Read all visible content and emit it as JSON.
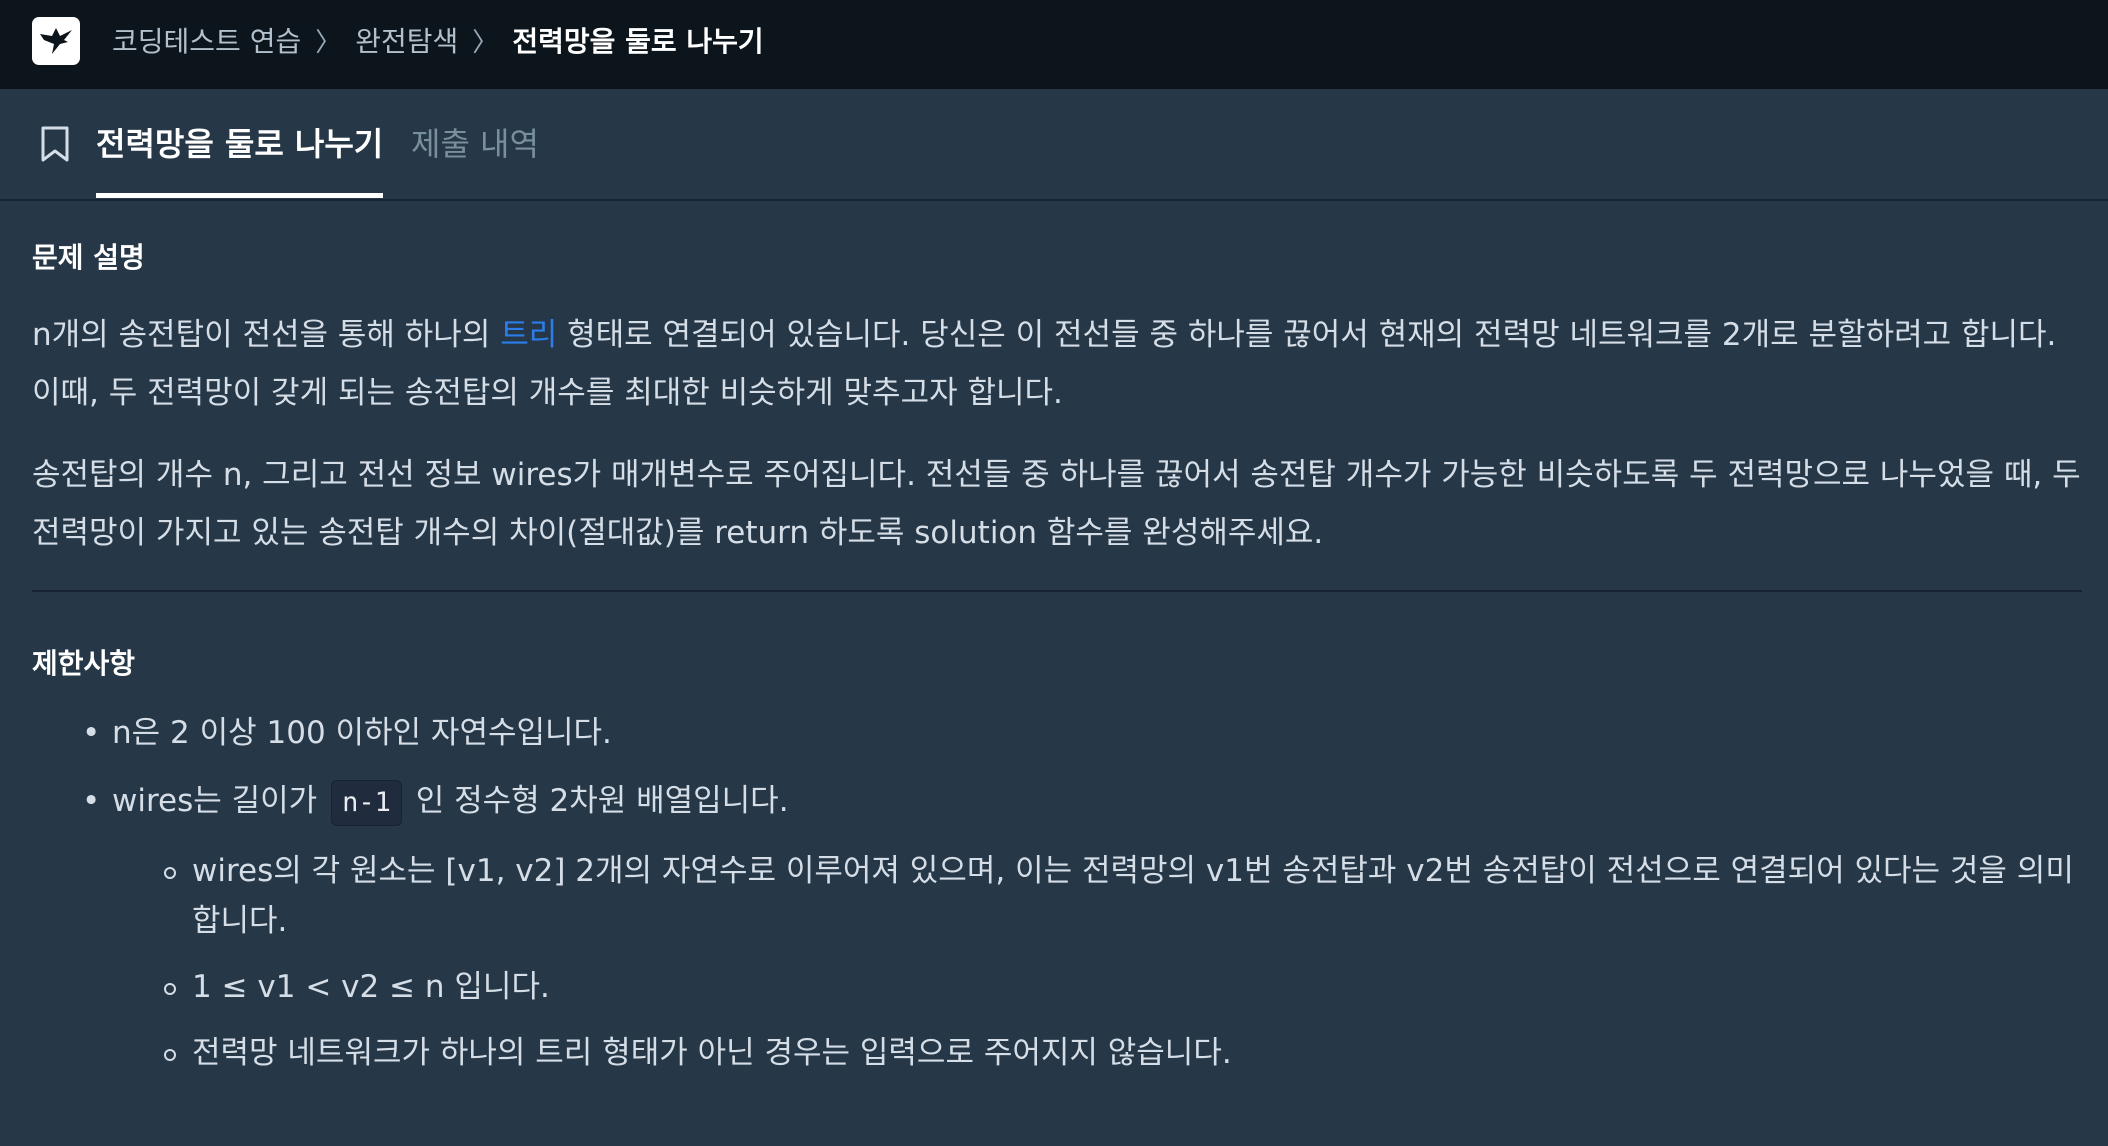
{
  "breadcrumb": {
    "items": [
      "코딩테스트 연습",
      "완전탐색",
      "전력망을 둘로 나누기"
    ],
    "separator": "〉"
  },
  "tabs": {
    "active": "전력망을 둘로 나누기",
    "submissions": "제출 내역"
  },
  "description": {
    "heading": "문제 설명",
    "p1_before_link": "n개의 송전탑이 전선을 통해 하나의 ",
    "p1_link": "트리",
    "p1_after_link": " 형태로 연결되어 있습니다. 당신은 이 전선들 중 하나를 끊어서 현재의 전력망 네트워크를 2개로 분할하려고 합니다. 이때, 두 전력망이 갖게 되는 송전탑의 개수를 최대한 비슷하게 맞추고자 합니다.",
    "p2": "송전탑의 개수 n, 그리고 전선 정보 wires가 매개변수로 주어집니다. 전선들 중 하나를 끊어서 송전탑 개수가 가능한 비슷하도록 두 전력망으로 나누었을 때, 두 전력망이 가지고 있는 송전탑 개수의 차이(절대값)를 return 하도록 solution 함수를 완성해주세요."
  },
  "constraints": {
    "heading": "제한사항",
    "item1": "n은 2 이상 100 이하인 자연수입니다.",
    "item2_before": "wires는 길이가",
    "item2_code": "n-1",
    "item2_after": "인 정수형 2차원 배열입니다.",
    "sub_items": [
      "wires의 각 원소는 [v1, v2] 2개의 자연수로 이루어져 있으며, 이는 전력망의 v1번 송전탑과 v2번 송전탑이 전선으로 연결되어 있다는 것을 의미합니다.",
      "1 ≤ v1 < v2 ≤ n 입니다.",
      "전력망 네트워크가 하나의 트리 형태가 아닌 경우는 입력으로 주어지지 않습니다."
    ]
  },
  "colors": {
    "background": "#263747",
    "topbar": "#0c151c",
    "link": "#2b7de9"
  }
}
